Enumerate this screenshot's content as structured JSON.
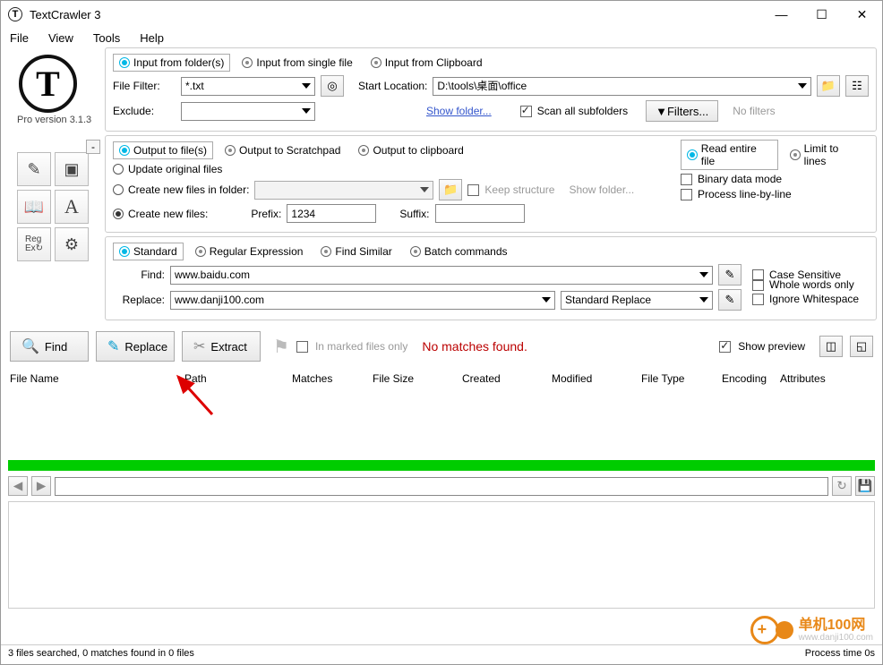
{
  "titlebar": {
    "title": "TextCrawler 3"
  },
  "menu": {
    "file": "File",
    "view": "View",
    "tools": "Tools",
    "help": "Help"
  },
  "version": "Pro version 3.1.3",
  "input": {
    "tab_folders": "Input from folder(s)",
    "tab_single": "Input from single file",
    "tab_clip": "Input from Clipboard",
    "file_filter_lbl": "File Filter:",
    "file_filter": "*.txt",
    "start_loc_lbl": "Start Location:",
    "start_loc": "D:\\tools\\桌面\\office",
    "exclude_lbl": "Exclude:",
    "exclude": "",
    "show_folder": "Show folder...",
    "scan_sub": "Scan all subfolders",
    "filters_btn": "Filters...",
    "no_filters": "No filters"
  },
  "output": {
    "tab_files": "Output to file(s)",
    "tab_scratch": "Output to Scratchpad",
    "tab_clip": "Output to clipboard",
    "update_orig": "Update original files",
    "create_in_folder": "Create new files in folder:",
    "keep_struct": "Keep structure",
    "show_folder": "Show folder...",
    "create_new": "Create new files:",
    "prefix_lbl": "Prefix:",
    "prefix": "1234",
    "suffix_lbl": "Suffix:",
    "suffix": "",
    "read_entire": "Read entire file",
    "limit_lines": "Limit to lines",
    "binary": "Binary data mode",
    "line_by_line": "Process line-by-line"
  },
  "search": {
    "tab_std": "Standard",
    "tab_regex": "Regular Expression",
    "tab_similar": "Find Similar",
    "tab_batch": "Batch commands",
    "find_lbl": "Find:",
    "find_val": "www.baidu.com",
    "replace_lbl": "Replace:",
    "replace_val": "www.danji100.com",
    "replace_mode": "Standard Replace",
    "case": "Case Sensitive",
    "whole": "Whole words only",
    "ignore_ws": "Ignore Whitespace"
  },
  "actions": {
    "find": "Find",
    "replace": "Replace",
    "extract": "Extract",
    "marked_only": "In marked files only",
    "no_matches": "No matches found.",
    "show_preview": "Show preview"
  },
  "columns": {
    "fname": "File Name",
    "path": "Path",
    "matches": "Matches",
    "fsize": "File Size",
    "created": "Created",
    "modified": "Modified",
    "ftype": "File Type",
    "encoding": "Encoding",
    "attrs": "Attributes"
  },
  "status": {
    "left": "3 files searched, 0 matches found in 0 files",
    "right": "Process time 0s"
  },
  "watermark": {
    "name": "单机100网",
    "url": "www.danji100.com"
  }
}
